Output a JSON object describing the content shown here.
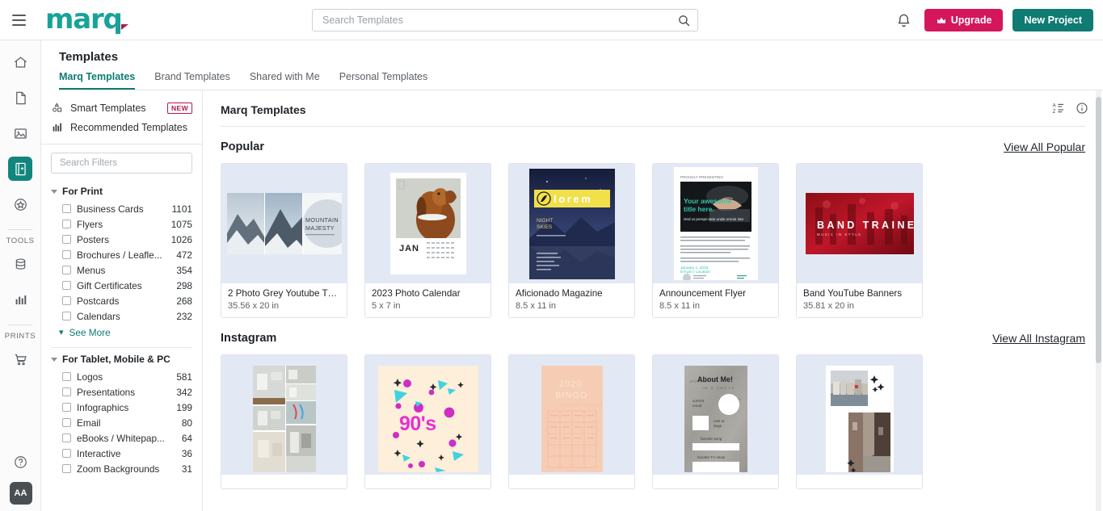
{
  "topbar": {
    "menu_icon": "hamburger-icon",
    "logo_text": "marq",
    "search": {
      "placeholder": "Search Templates",
      "value": "",
      "icon": "search-icon"
    },
    "bell_icon": "notification-bell-icon",
    "upgrade_label": "Upgrade",
    "upgrade_icon": "crown-icon",
    "new_project_label": "New Project",
    "colors": {
      "brand_teal": "#17a398",
      "upgrade_pink": "#d4175c",
      "new_project_teal": "#0f7b72",
      "logo_accent": "#b2194b"
    }
  },
  "rail": {
    "items": [
      {
        "icon": "home-icon",
        "active": false
      },
      {
        "icon": "document-icon",
        "active": false
      },
      {
        "icon": "image-icon",
        "active": false
      },
      {
        "icon": "templates-icon",
        "active": true
      },
      {
        "icon": "star-badge-icon",
        "active": false
      }
    ],
    "tools_label": "TOOLS",
    "tools_items": [
      {
        "icon": "database-icon"
      },
      {
        "icon": "bar-chart-icon"
      }
    ],
    "prints_label": "PRINTS",
    "prints_items": [
      {
        "icon": "shopping-cart-icon"
      }
    ],
    "help_icon": "help-circle-icon",
    "accessibility_label": "AA"
  },
  "page": {
    "title": "Templates",
    "tabs": [
      {
        "label": "Marq Templates",
        "active": true
      },
      {
        "label": "Brand Templates",
        "active": false
      },
      {
        "label": "Shared with Me",
        "active": false
      },
      {
        "label": "Personal Templates",
        "active": false
      }
    ],
    "sort_icon": "sort-az-icon",
    "info_icon": "info-icon"
  },
  "filters": {
    "smart_templates_label": "Smart Templates",
    "smart_templates_icon": "smart-templates-icon",
    "new_badge": "NEW",
    "recommended_label": "Recommended Templates",
    "recommended_icon": "recommended-chart-icon",
    "search": {
      "placeholder": "Search Filters",
      "value": "",
      "icon": "search-icon"
    },
    "groups": [
      {
        "title": "For Print",
        "expanded": true,
        "items": [
          {
            "label": "Business Cards",
            "count": "1101"
          },
          {
            "label": "Flyers",
            "count": "1075"
          },
          {
            "label": "Posters",
            "count": "1026"
          },
          {
            "label": "Brochures / Leafle...",
            "count": "472"
          },
          {
            "label": "Menus",
            "count": "354"
          },
          {
            "label": "Gift Certificates",
            "count": "298"
          },
          {
            "label": "Postcards",
            "count": "268"
          },
          {
            "label": "Calendars",
            "count": "232"
          }
        ],
        "see_more_label": "See More"
      },
      {
        "title": "For Tablet, Mobile & PC",
        "expanded": true,
        "items": [
          {
            "label": "Logos",
            "count": "581"
          },
          {
            "label": "Presentations",
            "count": "342"
          },
          {
            "label": "Infographics",
            "count": "199"
          },
          {
            "label": "Email",
            "count": "80"
          },
          {
            "label": "eBooks / Whitepap...",
            "count": "64"
          },
          {
            "label": "Interactive",
            "count": "36"
          },
          {
            "label": "Zoom Backgrounds",
            "count": "31"
          }
        ],
        "see_more_label": ""
      }
    ]
  },
  "gallery": {
    "heading": "Marq Templates",
    "sections": [
      {
        "title": "Popular",
        "view_all_label": "View All Popular",
        "cards": [
          {
            "name": "2 Photo Grey Youtube Th...",
            "size": "35.56 x 20 in",
            "art": "mountain-majesty"
          },
          {
            "name": "2023 Photo Calendar",
            "size": "5 x 7 in",
            "art": "dog-calendar"
          },
          {
            "name": "Aficionado Magazine",
            "size": "8.5 x 11 in",
            "art": "lorem-magazine"
          },
          {
            "name": "Announcement Flyer",
            "size": "8.5 x 11 in",
            "art": "announcement-flyer"
          },
          {
            "name": "Band YouTube Banners",
            "size": "35.81 x 20 in",
            "art": "band-trainer"
          }
        ]
      },
      {
        "title": "Instagram",
        "view_all_label": "View All Instagram",
        "cards": [
          {
            "name": "",
            "size": "",
            "art": "kitchen-collage"
          },
          {
            "name": "",
            "size": "",
            "art": "nineties-party"
          },
          {
            "name": "",
            "size": "",
            "art": "bingo-2020"
          },
          {
            "name": "",
            "size": "",
            "art": "about-me"
          },
          {
            "name": "",
            "size": "",
            "art": "travel-photos"
          }
        ]
      }
    ]
  }
}
